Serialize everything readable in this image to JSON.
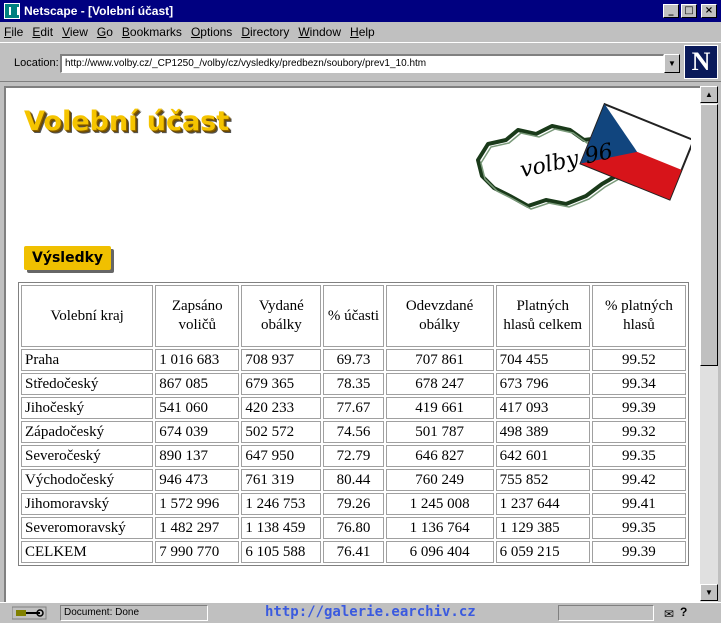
{
  "window": {
    "title": "Netscape - [Volební účast]"
  },
  "menu": [
    "File",
    "Edit",
    "View",
    "Go",
    "Bookmarks",
    "Options",
    "Directory",
    "Window",
    "Help"
  ],
  "location": {
    "label": "Location:",
    "url": "http://www.volby.cz/_CP1250_/volby/cz/vysledky/predbezn/soubory/prev1_10.htm"
  },
  "brand_letter": "N",
  "page": {
    "heading": "Volební účast",
    "logo_text": "volby 96",
    "tag": "Výsledky"
  },
  "table": {
    "headers": [
      "Volební kraj",
      "Zapsáno voličů",
      "Vydané obálky",
      "% účasti",
      "Odevzdané obálky",
      "Platných hlasů celkem",
      "% platných hlasů"
    ],
    "rows": [
      [
        "Praha",
        "1 016 683",
        "708 937",
        "69.73",
        "707 861",
        "704 455",
        "99.52"
      ],
      [
        "Středočeský",
        "867 085",
        "679 365",
        "78.35",
        "678 247",
        "673 796",
        "99.34"
      ],
      [
        "Jihočeský",
        "541 060",
        "420 233",
        "77.67",
        "419 661",
        "417 093",
        "99.39"
      ],
      [
        "Západočeský",
        "674 039",
        "502 572",
        "74.56",
        "501 787",
        "498 389",
        "99.32"
      ],
      [
        "Severočeský",
        "890 137",
        "647 950",
        "72.79",
        "646 827",
        "642 601",
        "99.35"
      ],
      [
        "Východočeský",
        "946 473",
        "761 319",
        "80.44",
        "760 249",
        "755 852",
        "99.42"
      ],
      [
        "Jihomoravský",
        "1 572 996",
        "1 246 753",
        "79.26",
        "1 245 008",
        "1 237 644",
        "99.41"
      ],
      [
        "Severomoravský",
        "1 482 297",
        "1 138 459",
        "76.80",
        "1 136 764",
        "1 129 385",
        "99.35"
      ],
      [
        "CELKEM",
        "7 990 770",
        "6 105 588",
        "76.41",
        "6 096 404",
        "6 059 215",
        "99.39"
      ]
    ]
  },
  "status": {
    "text": "Document: Done",
    "watermark": "http://galerie.earchiv.cz"
  },
  "colors": {
    "titlebar": "#000080",
    "heading": "#f5c400",
    "tag": "#f0c000",
    "watermark": "#3a5adf"
  }
}
